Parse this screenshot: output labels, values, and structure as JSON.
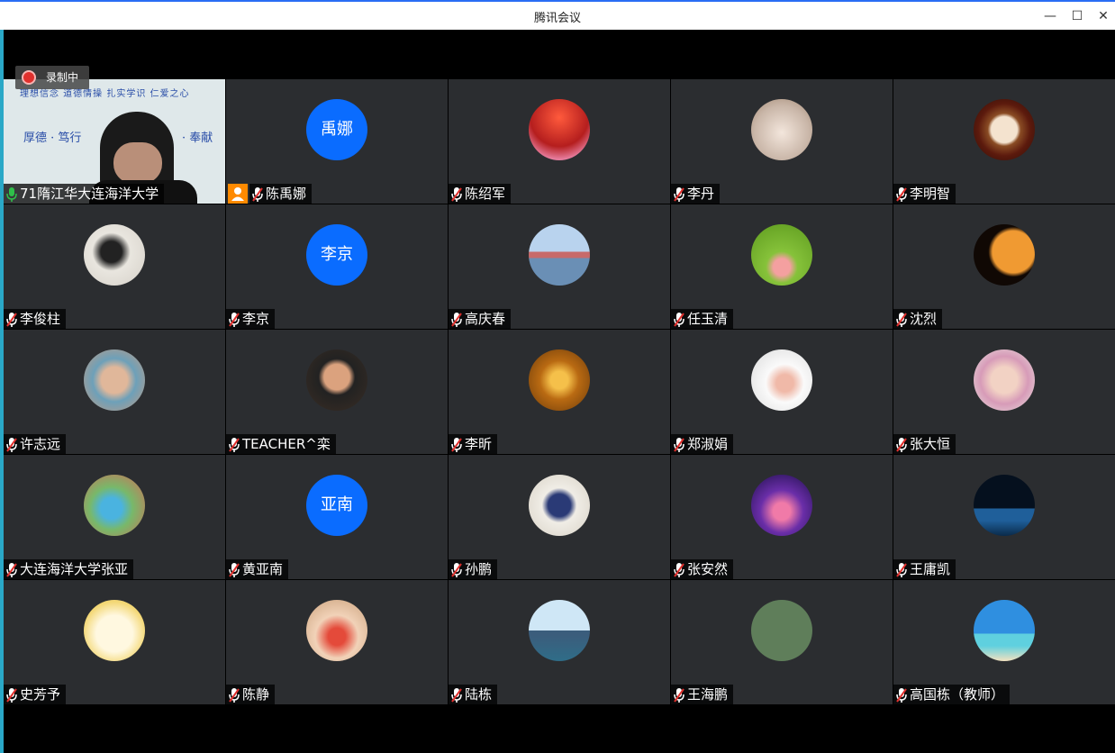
{
  "window": {
    "title": "腾讯会议",
    "minimize": "—",
    "maximize": "☐",
    "close": "✕"
  },
  "recording": {
    "label": "录制中"
  },
  "main_video": {
    "slogan_top": "理想信念  道德情操  扎实学识  仁爱之心",
    "slogan_left": "厚德 · 笃行",
    "slogan_right": "· 奉献"
  },
  "participants": [
    {
      "name": "71隋江华大连海洋大学",
      "avatar": "video",
      "mic": "on"
    },
    {
      "name": "陈禹娜",
      "avatar": "text",
      "avatar_text": "禹娜",
      "mic": "muted",
      "host": true
    },
    {
      "name": "陈绍军",
      "avatar": "autumn-trees",
      "mic": "muted"
    },
    {
      "name": "李丹",
      "avatar": "bunny-toys",
      "mic": "muted"
    },
    {
      "name": "李明智",
      "avatar": "coffee-cup",
      "mic": "muted"
    },
    {
      "name": "李俊柱",
      "avatar": "ink-painting",
      "mic": "muted"
    },
    {
      "name": "李京",
      "avatar": "text",
      "avatar_text": "李京",
      "mic": "muted"
    },
    {
      "name": "高庆春",
      "avatar": "lake-landscape",
      "mic": "muted"
    },
    {
      "name": "任玉清",
      "avatar": "dandelion",
      "mic": "muted"
    },
    {
      "name": "沈烈",
      "avatar": "eclipse",
      "mic": "muted"
    },
    {
      "name": "许志远",
      "avatar": "child-photo",
      "mic": "muted"
    },
    {
      "name": "TEACHER^栾",
      "avatar": "sunglasses-photo",
      "mic": "muted"
    },
    {
      "name": "李昕",
      "avatar": "golden-spoon",
      "mic": "muted"
    },
    {
      "name": "郑淑娟",
      "avatar": "cartoon-desk",
      "mic": "muted"
    },
    {
      "name": "张大恒",
      "avatar": "toddler-photo",
      "mic": "muted"
    },
    {
      "name": "大连海洋大学张亚",
      "avatar": "playground",
      "mic": "muted"
    },
    {
      "name": "黄亚南",
      "avatar": "text",
      "avatar_text": "亚南",
      "mic": "muted"
    },
    {
      "name": "孙鹏",
      "avatar": "calligraphy",
      "mic": "muted"
    },
    {
      "name": "张安然",
      "avatar": "starry-girls",
      "mic": "muted"
    },
    {
      "name": "王庸凯",
      "avatar": "night-moon",
      "mic": "muted"
    },
    {
      "name": "史芳予",
      "avatar": "duck-sticker",
      "mic": "muted"
    },
    {
      "name": "陈静",
      "avatar": "kid-cake",
      "mic": "muted"
    },
    {
      "name": "陆栋",
      "avatar": "bridge-sky",
      "mic": "muted"
    },
    {
      "name": "王海鹏",
      "avatar": "green-seal",
      "mic": "muted"
    },
    {
      "name": "高国栋（教师）",
      "avatar": "beach-sky",
      "mic": "muted"
    }
  ],
  "colors": {
    "tile_bg": "#2b2d30",
    "avatar_blue": "#0a6cff",
    "mic_muted_red": "#e0302d",
    "mic_on_green": "#2fbf4a",
    "host_orange": "#ff8a00"
  }
}
